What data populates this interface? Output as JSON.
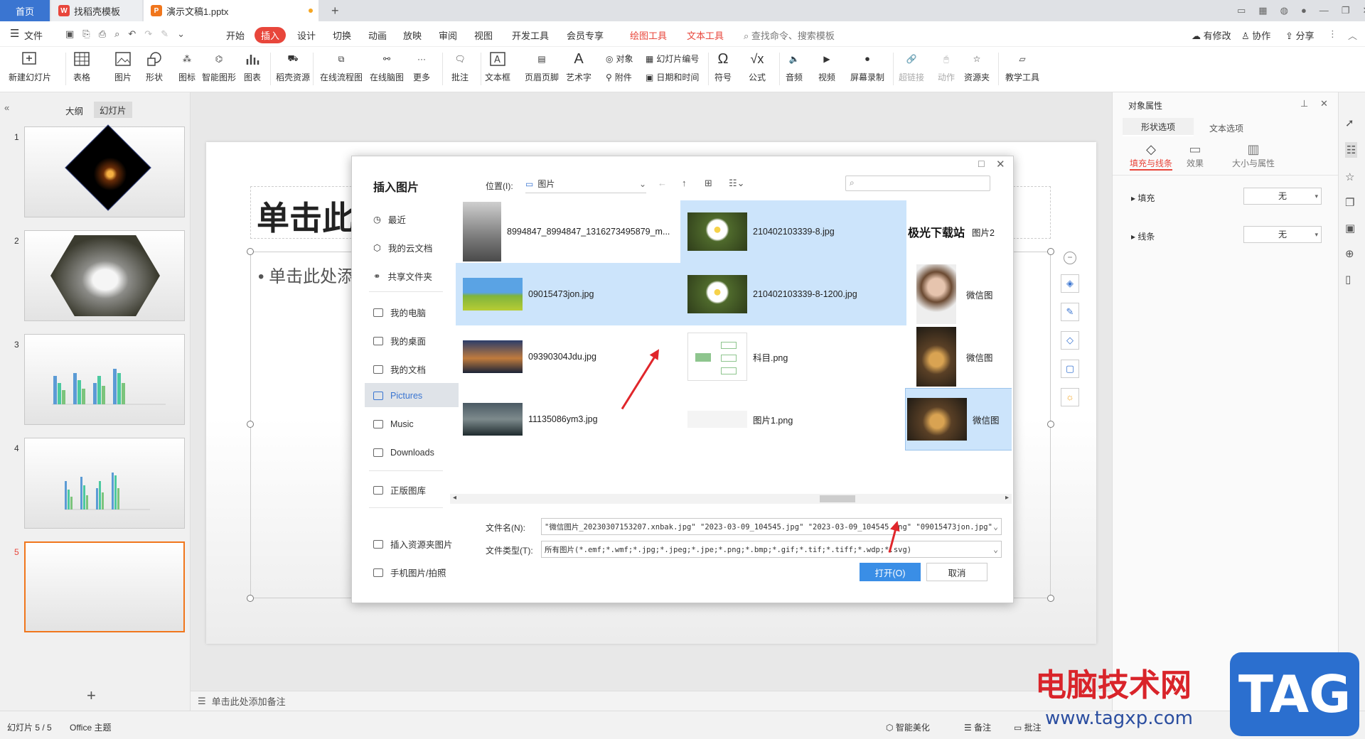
{
  "tabs": {
    "home": "首页",
    "template": "找稻壳模板",
    "doc": "演示文稿1.pptx",
    "new": "+"
  },
  "menubar": {
    "file": "文件",
    "items": [
      "开始",
      "插入",
      "设计",
      "切换",
      "动画",
      "放映",
      "审阅",
      "视图",
      "开发工具",
      "会员专享"
    ],
    "active": "插入",
    "context": [
      "绘图工具",
      "文本工具"
    ],
    "search": "查找命令、搜索模板",
    "right": [
      "有修改",
      "协作",
      "分享"
    ]
  },
  "ribbon": {
    "items": [
      "新建幻灯片",
      "表格",
      "图片",
      "形状",
      "图标",
      "智能图形",
      "图表",
      "稻壳资源",
      "在线流程图",
      "在线脑图",
      "更多",
      "批注",
      "文本框",
      "页眉页脚",
      "艺术字",
      "符号",
      "公式",
      "音频",
      "视频",
      "屏幕录制",
      "超链接",
      "动作",
      "资源夹",
      "教学工具"
    ],
    "small": [
      "对象",
      "幻灯片编号",
      "附件",
      "日期和时间"
    ]
  },
  "leftpanel": {
    "tabs": [
      "大纲",
      "幻灯片"
    ],
    "active_tab": "幻灯片",
    "slides": [
      "1",
      "2",
      "3",
      "4",
      "5"
    ],
    "add": "+"
  },
  "slide": {
    "title": "单击此",
    "bullet": "单击此处添"
  },
  "notes": "单击此处添加备注",
  "rightpanel": {
    "header": "对象属性",
    "tabs": [
      "形状选项",
      "文本选项"
    ],
    "subtabs": [
      "填充与线条",
      "效果",
      "大小与属性"
    ],
    "fill_label": "填充",
    "fill_value": "无",
    "line_label": "线条",
    "line_value": "无"
  },
  "status": {
    "slide": "幻灯片 5 / 5",
    "theme": "Office 主题",
    "beautify": "智能美化",
    "notes": "备注",
    "comment": "批注"
  },
  "dialog": {
    "title": "插入图片",
    "location_label": "位置(I):",
    "location_value": "图片",
    "nav": [
      "最近",
      "我的云文档",
      "共享文件夹",
      "我的电脑",
      "我的桌面",
      "我的文档",
      "Pictures",
      "Music",
      "Downloads",
      "正版图库",
      "插入资源夹图片",
      "手机图片/拍照"
    ],
    "nav_active": "Pictures",
    "files": [
      {
        "name": "8994847_8994847_1316273495879_m...",
        "selected": false
      },
      {
        "name": "210402103339-8.jpg",
        "selected": true
      },
      {
        "name": "图片2",
        "selected": false
      },
      {
        "name": "09015473jon.jpg",
        "selected": true
      },
      {
        "name": "210402103339-8-1200.jpg",
        "selected": true
      },
      {
        "name": "微信图",
        "selected": false
      },
      {
        "name": "09390304Jdu.jpg",
        "selected": false
      },
      {
        "name": "科目.png",
        "selected": false
      },
      {
        "name": "微信图",
        "selected": false
      },
      {
        "name": "11135086ym3.jpg",
        "selected": false
      },
      {
        "name": "图片1.png",
        "selected": false
      },
      {
        "name": "微信图",
        "selected": true
      }
    ],
    "logo_text": "极光下载站",
    "filename_label": "文件名(N):",
    "filename_value": "\"微信图片_20230307153207.xnbak.jpg\" \"2023-03-09_104545.jpg\" \"2023-03-09_104545.png\" \"09015473jon.jpg\"",
    "filetype_label": "文件类型(T):",
    "filetype_value": "所有图片(*.emf;*.wmf;*.jpg;*.jpeg;*.jpe;*.png;*.bmp;*.gif;*.tif;*.tiff;*.wdp;*.svg)",
    "open": "打开(O)",
    "cancel": "取消"
  },
  "watermark": {
    "text": "电脑技术网",
    "url": "www.tagxp.com",
    "tag": "TAG"
  },
  "colors": {
    "accent": "#e8463b",
    "blue": "#3a75d1",
    "selection": "#cce4fb"
  }
}
